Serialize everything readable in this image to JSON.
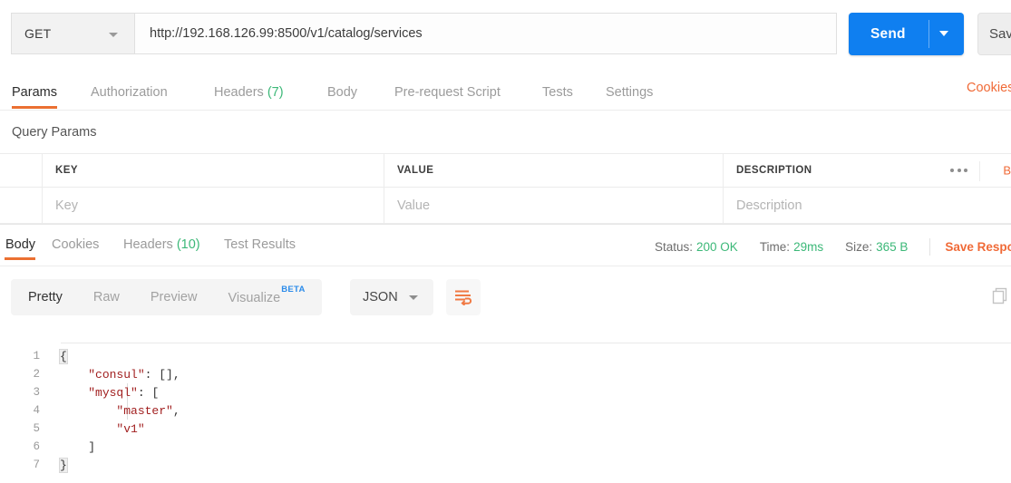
{
  "request": {
    "method": "GET",
    "url": "http://192.168.126.99:8500/v1/catalog/services",
    "send_label": "Send",
    "save_label": "Save",
    "method_caret_icon": "chevron-down-icon",
    "send_caret_icon": "chevron-down-icon"
  },
  "request_tabs": {
    "items": [
      {
        "label": "Params",
        "count": "",
        "active": true
      },
      {
        "label": "Authorization",
        "count": "",
        "active": false
      },
      {
        "label": "Headers",
        "count": "(7)",
        "active": false
      },
      {
        "label": "Body",
        "count": "",
        "active": false
      },
      {
        "label": "Pre-request Script",
        "count": "",
        "active": false
      },
      {
        "label": "Tests",
        "count": "",
        "active": false
      },
      {
        "label": "Settings",
        "count": "",
        "active": false
      }
    ],
    "cookies_link": "Cookies"
  },
  "query_params": {
    "section_title": "Query Params",
    "headers": {
      "key": "KEY",
      "value": "VALUE",
      "description": "DESCRIPTION"
    },
    "placeholders": {
      "key": "Key",
      "value": "Value",
      "description": "Description"
    },
    "more_icon": "ellipsis-icon",
    "bulk_edit_label": "B"
  },
  "response_tabs": {
    "items": [
      {
        "label": "Body",
        "count": "",
        "active": true
      },
      {
        "label": "Cookies",
        "count": "",
        "active": false
      },
      {
        "label": "Headers",
        "count": "(10)",
        "active": false
      },
      {
        "label": "Test Results",
        "count": "",
        "active": false
      }
    ]
  },
  "response_meta": {
    "status_label": "Status:",
    "status_value": "200 OK",
    "time_label": "Time:",
    "time_value": "29ms",
    "size_label": "Size:",
    "size_value": "365 B",
    "save_response_label": "Save Respo"
  },
  "body_toolbar": {
    "views": [
      {
        "label": "Pretty",
        "active": true
      },
      {
        "label": "Raw",
        "active": false
      },
      {
        "label": "Preview",
        "active": false
      },
      {
        "label": "Visualize",
        "active": false,
        "badge": "BETA"
      }
    ],
    "format": "JSON",
    "wrap_icon": "word-wrap-icon",
    "copy_icon": "copy-icon"
  },
  "response_body": {
    "language": "json",
    "lines": [
      {
        "n": "1",
        "indent": 0,
        "tokens": [
          {
            "t": "{",
            "c": "brk"
          }
        ]
      },
      {
        "n": "2",
        "indent": 1,
        "tokens": [
          {
            "t": "\"consul\"",
            "c": "k"
          },
          {
            "t": ": ",
            "c": "p"
          },
          {
            "t": "[],",
            "c": "p"
          }
        ]
      },
      {
        "n": "3",
        "indent": 1,
        "tokens": [
          {
            "t": "\"mysql\"",
            "c": "k"
          },
          {
            "t": ": ",
            "c": "p"
          },
          {
            "t": "[",
            "c": "p"
          }
        ]
      },
      {
        "n": "4",
        "indent": 2,
        "tokens": [
          {
            "t": "\"master\"",
            "c": "s"
          },
          {
            "t": ",",
            "c": "p"
          }
        ]
      },
      {
        "n": "5",
        "indent": 2,
        "tokens": [
          {
            "t": "\"v1\"",
            "c": "s"
          }
        ]
      },
      {
        "n": "6",
        "indent": 1,
        "tokens": [
          {
            "t": "]",
            "c": "p"
          }
        ]
      },
      {
        "n": "7",
        "indent": 0,
        "tokens": [
          {
            "t": "}",
            "c": "brk"
          }
        ]
      }
    ],
    "raw": "{\n    \"consul\": [],\n    \"mysql\": [\n        \"master\",\n        \"v1\"\n    ]\n}"
  },
  "colors": {
    "accent_orange": "#eb7032",
    "send_blue": "#0f7ff0",
    "status_green": "#3cb878",
    "beta_blue": "#2b8bea",
    "json_key_red": "#a11f1f"
  }
}
